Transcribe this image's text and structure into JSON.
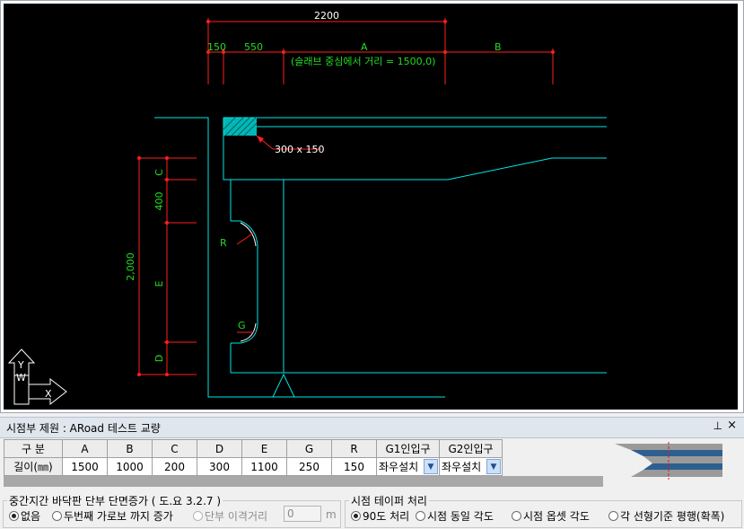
{
  "drawing": {
    "dims": {
      "total": "2200",
      "d150": "150",
      "d550": "550",
      "dA": "A",
      "dB": "B",
      "note": "(슬래브 중심에서 거리 = 1500,0)",
      "size": "300 x 150",
      "vC": "C",
      "v400": "400",
      "v2000": "2,000",
      "vE": "E",
      "vD": "D",
      "R": "R",
      "G": "G"
    },
    "axis": {
      "y": "Y",
      "x": "X",
      "w": "W"
    },
    "colors": {
      "red": "#ff1e1e",
      "cyan": "#00e6e6",
      "green": "#22dd22",
      "white": "#ffffff",
      "black": "#000000"
    }
  },
  "panel": {
    "title": "시점부 제원 : ARoad 테스트 교량",
    "pin": "📌",
    "close": "✕"
  },
  "table": {
    "headers": [
      "구 분",
      "A",
      "B",
      "C",
      "D",
      "E",
      "G",
      "R",
      "G1인입구",
      "G2인입구"
    ],
    "row_label": "길이(㎜)",
    "values": [
      "1500",
      "1000",
      "200",
      "300",
      "1100",
      "250",
      "150"
    ],
    "g1": "좌우설치",
    "g2": "좌우설치"
  },
  "group_left": {
    "title": "중간지간 바닥판 단부 단면증가 ( 도.요 3.2.7 )",
    "options": [
      "없음",
      "두번째 가로보 까지 증가",
      "단부 이격거리"
    ],
    "selected": 0,
    "distance_value": "0",
    "unit": "m"
  },
  "group_right": {
    "title": "시점 테이퍼 처리",
    "options": [
      "90도 처리",
      "시점 동일 각도",
      "시점 옵셋 각도",
      "각 선형기준 평행(확폭)"
    ],
    "selected": 0
  }
}
